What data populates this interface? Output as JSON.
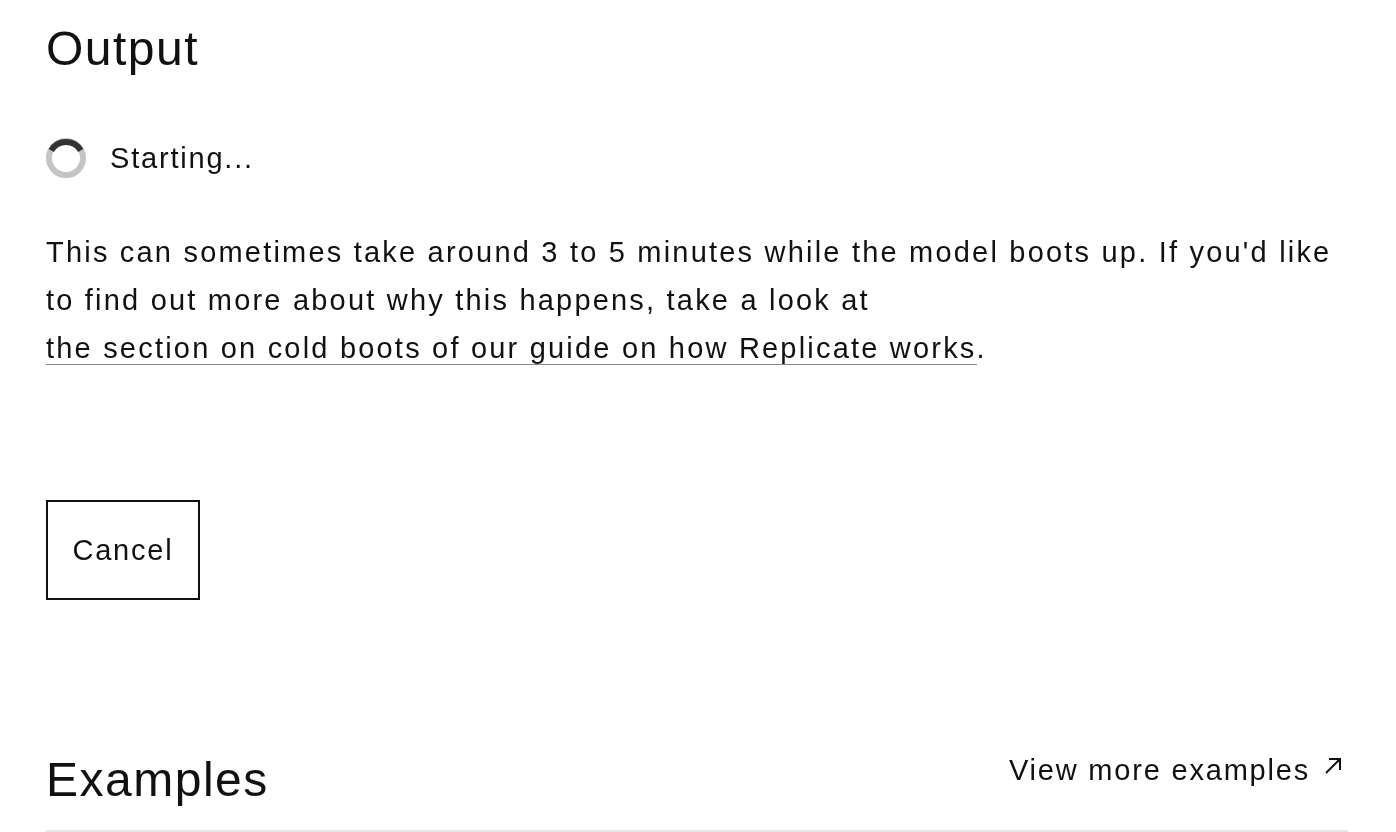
{
  "output": {
    "title": "Output",
    "status": {
      "text": "Starting..."
    },
    "message": {
      "text": "This can sometimes take around 3 to 5 minutes while the model boots up. If you'd like to find out more about why this happens, take a look at ",
      "link": "the section on cold boots of our guide on how Replicate works",
      "end": "."
    },
    "buttons": [
      {
        "label": "Cancel"
      }
    ]
  },
  "examples": {
    "title": "Examples",
    "link": "View more examples"
  }
}
